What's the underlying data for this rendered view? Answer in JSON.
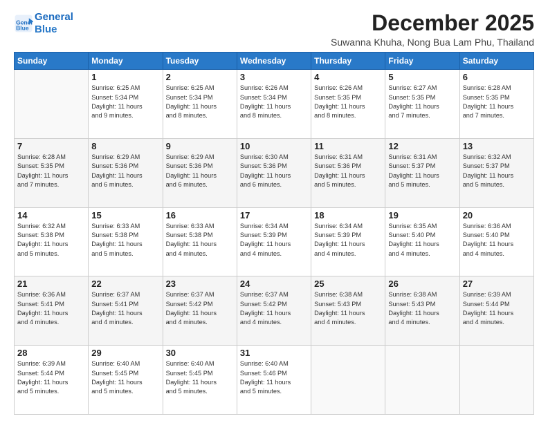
{
  "header": {
    "logo_line1": "General",
    "logo_line2": "Blue",
    "month_title": "December 2025",
    "subtitle": "Suwanna Khuha, Nong Bua Lam Phu, Thailand"
  },
  "days_of_week": [
    "Sunday",
    "Monday",
    "Tuesday",
    "Wednesday",
    "Thursday",
    "Friday",
    "Saturday"
  ],
  "weeks": [
    [
      {
        "day": "",
        "info": ""
      },
      {
        "day": "1",
        "info": "Sunrise: 6:25 AM\nSunset: 5:34 PM\nDaylight: 11 hours\nand 9 minutes."
      },
      {
        "day": "2",
        "info": "Sunrise: 6:25 AM\nSunset: 5:34 PM\nDaylight: 11 hours\nand 8 minutes."
      },
      {
        "day": "3",
        "info": "Sunrise: 6:26 AM\nSunset: 5:34 PM\nDaylight: 11 hours\nand 8 minutes."
      },
      {
        "day": "4",
        "info": "Sunrise: 6:26 AM\nSunset: 5:35 PM\nDaylight: 11 hours\nand 8 minutes."
      },
      {
        "day": "5",
        "info": "Sunrise: 6:27 AM\nSunset: 5:35 PM\nDaylight: 11 hours\nand 7 minutes."
      },
      {
        "day": "6",
        "info": "Sunrise: 6:28 AM\nSunset: 5:35 PM\nDaylight: 11 hours\nand 7 minutes."
      }
    ],
    [
      {
        "day": "7",
        "info": "Sunrise: 6:28 AM\nSunset: 5:35 PM\nDaylight: 11 hours\nand 7 minutes."
      },
      {
        "day": "8",
        "info": "Sunrise: 6:29 AM\nSunset: 5:36 PM\nDaylight: 11 hours\nand 6 minutes."
      },
      {
        "day": "9",
        "info": "Sunrise: 6:29 AM\nSunset: 5:36 PM\nDaylight: 11 hours\nand 6 minutes."
      },
      {
        "day": "10",
        "info": "Sunrise: 6:30 AM\nSunset: 5:36 PM\nDaylight: 11 hours\nand 6 minutes."
      },
      {
        "day": "11",
        "info": "Sunrise: 6:31 AM\nSunset: 5:36 PM\nDaylight: 11 hours\nand 5 minutes."
      },
      {
        "day": "12",
        "info": "Sunrise: 6:31 AM\nSunset: 5:37 PM\nDaylight: 11 hours\nand 5 minutes."
      },
      {
        "day": "13",
        "info": "Sunrise: 6:32 AM\nSunset: 5:37 PM\nDaylight: 11 hours\nand 5 minutes."
      }
    ],
    [
      {
        "day": "14",
        "info": "Sunrise: 6:32 AM\nSunset: 5:38 PM\nDaylight: 11 hours\nand 5 minutes."
      },
      {
        "day": "15",
        "info": "Sunrise: 6:33 AM\nSunset: 5:38 PM\nDaylight: 11 hours\nand 5 minutes."
      },
      {
        "day": "16",
        "info": "Sunrise: 6:33 AM\nSunset: 5:38 PM\nDaylight: 11 hours\nand 4 minutes."
      },
      {
        "day": "17",
        "info": "Sunrise: 6:34 AM\nSunset: 5:39 PM\nDaylight: 11 hours\nand 4 minutes."
      },
      {
        "day": "18",
        "info": "Sunrise: 6:34 AM\nSunset: 5:39 PM\nDaylight: 11 hours\nand 4 minutes."
      },
      {
        "day": "19",
        "info": "Sunrise: 6:35 AM\nSunset: 5:40 PM\nDaylight: 11 hours\nand 4 minutes."
      },
      {
        "day": "20",
        "info": "Sunrise: 6:36 AM\nSunset: 5:40 PM\nDaylight: 11 hours\nand 4 minutes."
      }
    ],
    [
      {
        "day": "21",
        "info": "Sunrise: 6:36 AM\nSunset: 5:41 PM\nDaylight: 11 hours\nand 4 minutes."
      },
      {
        "day": "22",
        "info": "Sunrise: 6:37 AM\nSunset: 5:41 PM\nDaylight: 11 hours\nand 4 minutes."
      },
      {
        "day": "23",
        "info": "Sunrise: 6:37 AM\nSunset: 5:42 PM\nDaylight: 11 hours\nand 4 minutes."
      },
      {
        "day": "24",
        "info": "Sunrise: 6:37 AM\nSunset: 5:42 PM\nDaylight: 11 hours\nand 4 minutes."
      },
      {
        "day": "25",
        "info": "Sunrise: 6:38 AM\nSunset: 5:43 PM\nDaylight: 11 hours\nand 4 minutes."
      },
      {
        "day": "26",
        "info": "Sunrise: 6:38 AM\nSunset: 5:43 PM\nDaylight: 11 hours\nand 4 minutes."
      },
      {
        "day": "27",
        "info": "Sunrise: 6:39 AM\nSunset: 5:44 PM\nDaylight: 11 hours\nand 4 minutes."
      }
    ],
    [
      {
        "day": "28",
        "info": "Sunrise: 6:39 AM\nSunset: 5:44 PM\nDaylight: 11 hours\nand 5 minutes."
      },
      {
        "day": "29",
        "info": "Sunrise: 6:40 AM\nSunset: 5:45 PM\nDaylight: 11 hours\nand 5 minutes."
      },
      {
        "day": "30",
        "info": "Sunrise: 6:40 AM\nSunset: 5:45 PM\nDaylight: 11 hours\nand 5 minutes."
      },
      {
        "day": "31",
        "info": "Sunrise: 6:40 AM\nSunset: 5:46 PM\nDaylight: 11 hours\nand 5 minutes."
      },
      {
        "day": "",
        "info": ""
      },
      {
        "day": "",
        "info": ""
      },
      {
        "day": "",
        "info": ""
      }
    ]
  ]
}
